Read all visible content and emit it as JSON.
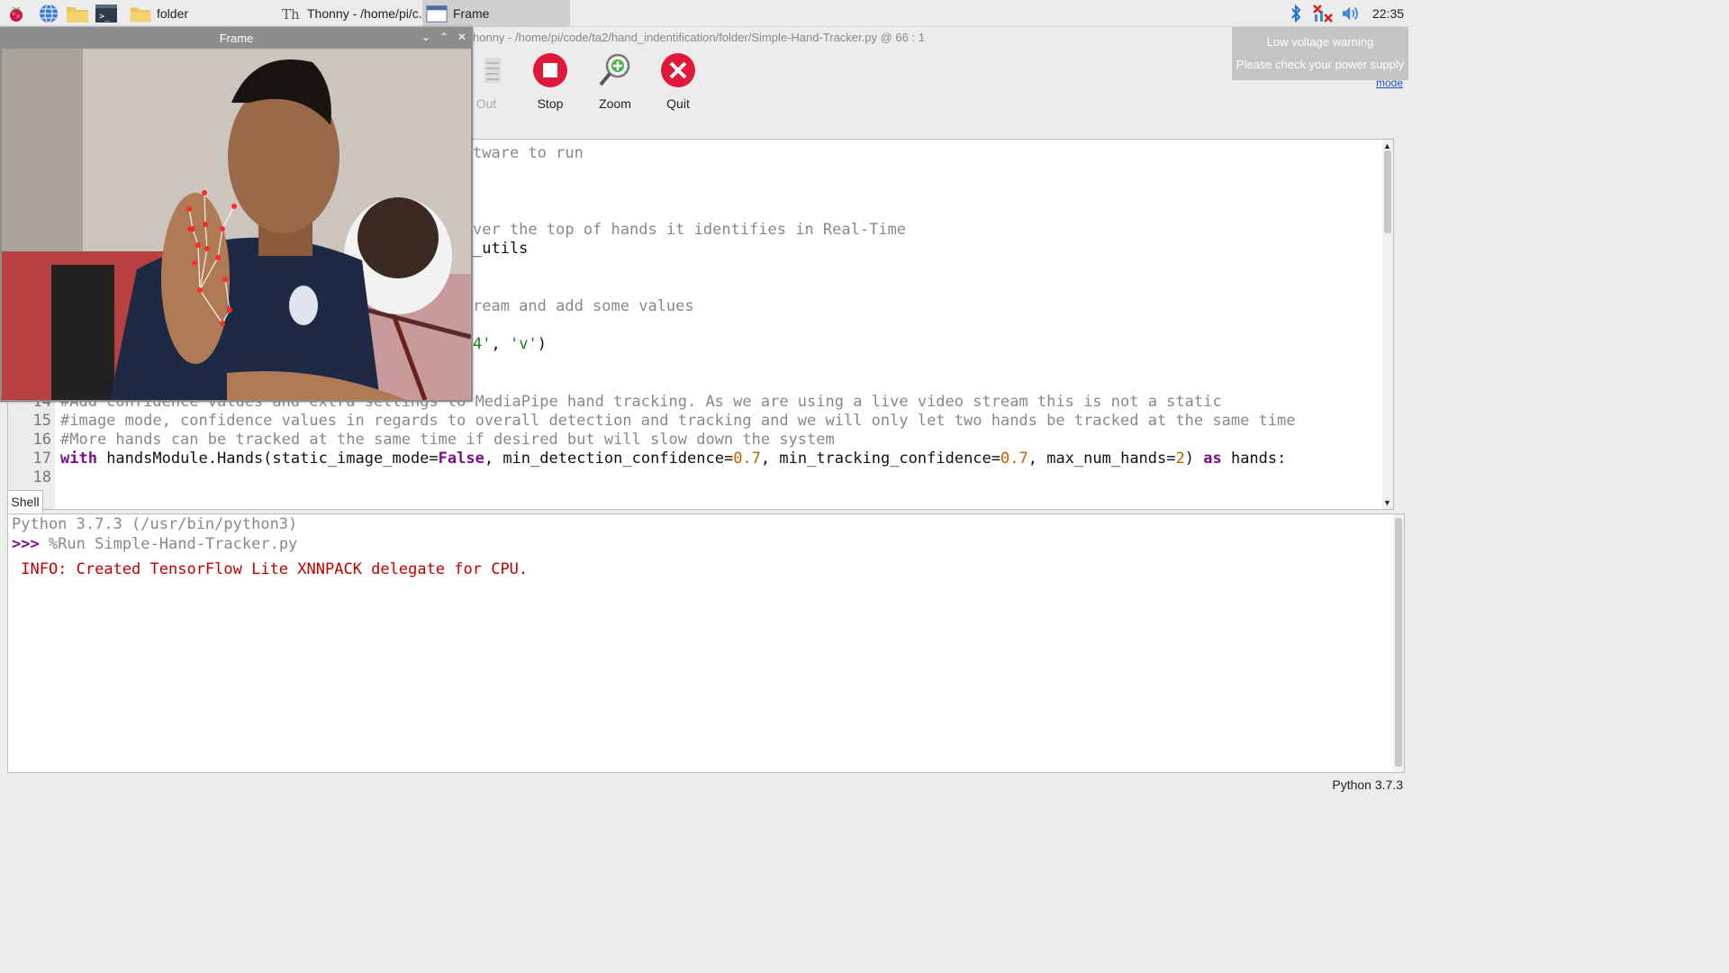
{
  "taskbar": {
    "launchers": [
      "raspberry-menu-icon",
      "web-browser-icon",
      "file-manager-icon",
      "terminal-icon"
    ],
    "tasks": [
      {
        "label": "folder",
        "icon": "folder-icon"
      },
      {
        "label": "Thonny  -  /home/pi/c...",
        "icon": "thonny-icon"
      },
      {
        "label": "Frame",
        "icon": "window-icon"
      }
    ],
    "tray": [
      "bluetooth-icon",
      "network-disconnected-icon",
      "volume-icon"
    ],
    "clock": "22:35"
  },
  "notification": {
    "title": "Low voltage warning",
    "message": "Please check your power supply"
  },
  "thonny": {
    "title": "Thonny  -  /home/pi/code/ta2/hand_indentification/folder/Simple-Hand-Tracker.py  @  66 : 1",
    "title_visible": "honny  -  /home/pi/code/ta2/hand_indentification/folder/Simple-Hand-Tracker.py  @  66 : 1",
    "toolbar": [
      {
        "label": "Out",
        "icon": "step-out-icon",
        "enabled": false
      },
      {
        "label": "Stop",
        "icon": "stop-icon",
        "enabled": true
      },
      {
        "label": "Zoom",
        "icon": "zoom-icon",
        "enabled": true
      },
      {
        "label": "Quit",
        "icon": "quit-icon",
        "enabled": true
      }
    ],
    "mode_link": "mode",
    "editor_fragments": {
      "l1": "tware to run",
      "l2": "ver the top of hands it identifies in Real-Time",
      "l3": "_utils",
      "l4": "ream and add some values",
      "l5a": "4'",
      "l5b": ", ",
      "l5c": "'v'",
      "l5d": ")"
    },
    "editor_lines": {
      "l14": {
        "num": "14",
        "text": "#Add confidence values and extra settings to MediaPipe hand tracking. As we are using a live video stream this is not a static"
      },
      "l15": {
        "num": "15",
        "text": "#image mode, confidence values in regards to overall detection and tracking and we will only let two hands be tracked at the same time"
      },
      "l16": {
        "num": "16",
        "text": "#More hands can be tracked at the same time if desired but will slow down the system"
      },
      "l17": {
        "num": "17",
        "kw1": "with",
        "p1": " handsModule.Hands(static_image_mode=",
        "kw2": "False",
        "p2": ", min_detection_confidence=",
        "n1": "0.7",
        "p3": ", min_tracking_confidence=",
        "n2": "0.7",
        "p4": ", max_num_hands=",
        "n3": "2",
        "p5": ") ",
        "kw3": "as",
        "p6": " hands:"
      },
      "l18": {
        "num": "18"
      }
    },
    "shell": {
      "tab": "Shell",
      "version_line": "Python 3.7.3 (/usr/bin/python3)",
      "prompt": ">>>",
      "command": " %Run Simple-Hand-Tracker.py",
      "output": " INFO: Created TensorFlow Lite XNNPACK delegate for CPU."
    },
    "status": "Python 3.7.3"
  },
  "frame": {
    "title": "Frame",
    "controls": [
      "minimize-icon",
      "maximize-icon",
      "close-icon"
    ]
  }
}
